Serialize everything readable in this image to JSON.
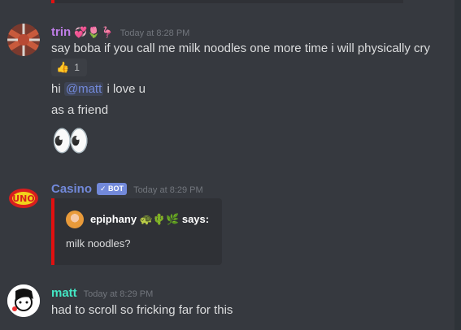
{
  "messages": {
    "trin": {
      "username": "trin",
      "username_color": "#c07ee8",
      "timestamp": "Today at 8:28 PM",
      "lines": [
        "say boba if you call me milk noodles one more time i will physically cry",
        "i love u",
        "as a friend"
      ],
      "hi_prefix": "hi",
      "mention": "@matt",
      "reaction": {
        "emoji": "👍",
        "count": "1"
      },
      "big_emoji": "👀",
      "name_emojis": [
        "💞",
        "🌷",
        "🦩"
      ]
    },
    "casino": {
      "username": "Casino",
      "username_color": "#7289da",
      "bot_tag": "✓ BOT",
      "timestamp": "Today at 8:29 PM",
      "embed": {
        "author": "epiphany 🐢🌵🌿 says:",
        "description": "milk noodles?",
        "accent_color": "#e01010"
      }
    },
    "matt": {
      "username": "matt",
      "username_color": "#43e6c4",
      "timestamp": "Today at 8:29 PM",
      "text": "had to scroll so fricking far for this"
    }
  }
}
